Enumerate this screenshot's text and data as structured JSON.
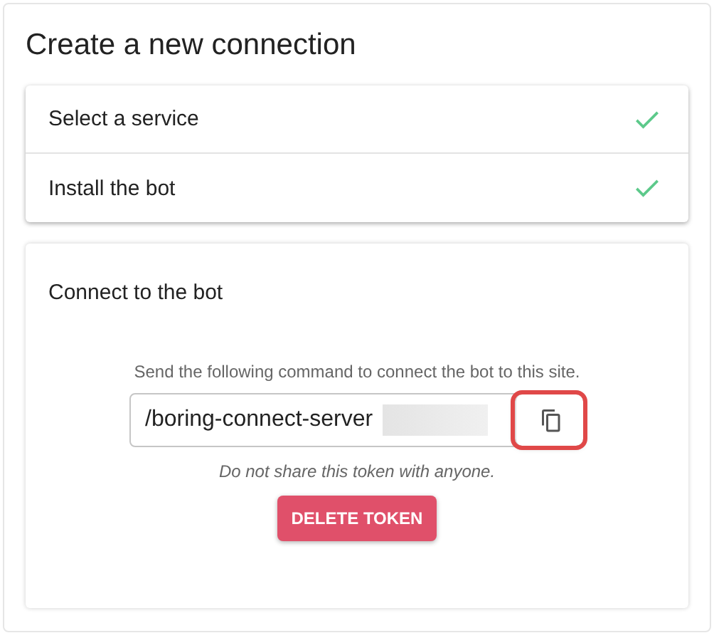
{
  "title": "Create a new connection",
  "steps": [
    {
      "label": "Select a service",
      "done": true
    },
    {
      "label": "Install the bot",
      "done": true
    }
  ],
  "connect": {
    "title": "Connect to the bot",
    "instruction": "Send the following command to connect the bot to this site.",
    "command": {
      "value": "/boring-connect-server",
      "redacted": true
    },
    "copy_button": {
      "highlighted": true
    },
    "note": "Do not share this token with anyone.",
    "delete_button": "DELETE TOKEN"
  }
}
